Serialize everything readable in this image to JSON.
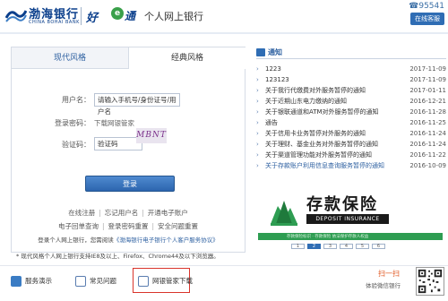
{
  "header": {
    "bank_name": "渤海银行",
    "bank_name_en": "CHINA BOHAI BANK",
    "slogan_part1": "好",
    "slogan_part2": "e",
    "slogan_part3": "通",
    "title": "个人网上银行",
    "hotline": "95541",
    "service_button": "在线客服"
  },
  "login": {
    "tab_modern": "现代风格",
    "tab_classic": "经典风格",
    "username_label": "用户名：",
    "username_value": "请输入手机号/身份证号/用户名",
    "password_label": "登录密码：",
    "password_hint": "下载网银管家",
    "captcha_label": "验证码：",
    "captcha_value": "验证码",
    "captcha_image_text": "MBNT",
    "login_button": "登录",
    "link_register": "在线注册",
    "link_forgot_username": "忘记用户名",
    "link_open_account": "开通电子账户",
    "link_digital_cert": "电子回单查询",
    "link_reset_password": "登录密码重置",
    "link_security_question": "安全问题重置",
    "agree_prefix": "登录个人网上银行，您需阅读",
    "agree_protocol": "《渤海银行电子银行个人客户服务协议》",
    "browser_note": "* 现代风格个人网上银行支持IE8及以上、Firefox、Chrome44及以下浏览器。"
  },
  "notices": {
    "title": "通知",
    "items": [
      {
        "text": "1223",
        "date": "2017-11-09",
        "highlight": false
      },
      {
        "text": "123123",
        "date": "2017-11-09",
        "highlight": false
      },
      {
        "text": "关于我行代缴费对外服务暂停的通知",
        "date": "2017-01-11",
        "highlight": false
      },
      {
        "text": "关于近期山东电力缴纳的通知",
        "date": "2016-12-21",
        "highlight": false
      },
      {
        "text": "关于银联通道和ATM对外服务暂停的通知",
        "date": "2016-11-28",
        "highlight": false
      },
      {
        "text": "通告",
        "date": "2016-11-25",
        "highlight": false
      },
      {
        "text": "关于信用卡业务暂停对外服务的通知",
        "date": "2016-11-24",
        "highlight": false
      },
      {
        "text": "关于理财、基金业务对外服务暂停的通知",
        "date": "2016-11-24",
        "highlight": false
      },
      {
        "text": "关于渠道管理功能对外服务暂停的通知",
        "date": "2016-11-22",
        "highlight": false
      },
      {
        "text": "关于存款账户利用信息查询服务暂停的通知",
        "date": "2016-10-09",
        "highlight": true
      }
    ]
  },
  "banner": {
    "title_cn": "存款保险",
    "title_en": "DEPOSIT INSURANCE",
    "strip_text": "存款保险标识 · 存款保险 依法保护存款人权益",
    "pages": [
      "1",
      "2",
      "3",
      "4",
      "5",
      "6"
    ],
    "active_page": 2
  },
  "footer": {
    "service_demo": "服务演示",
    "faq": "常见问题",
    "download_manager": "网银管家下载",
    "scan_title": "扫一扫",
    "scan_sub": "体验微信银行"
  },
  "colors": {
    "brand_blue": "#2f6db4",
    "highlight_red": "#d9342b",
    "banner_green": "#2e9d52"
  }
}
